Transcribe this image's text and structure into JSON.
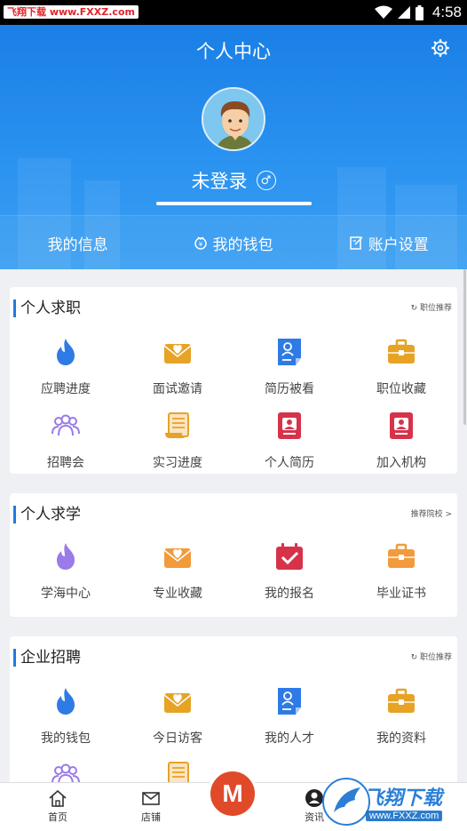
{
  "status_bar": {
    "watermark": "飞翔下载 www.FXXZ.com",
    "time": "4:58"
  },
  "header": {
    "title": "个人中心",
    "login_text": "未登录",
    "gender_symbol": "♂",
    "nav": [
      {
        "label": "我的信息",
        "icon": ""
      },
      {
        "label": "我的钱包",
        "icon": "wallet-icon"
      },
      {
        "label": "账户设置",
        "icon": "edit-icon"
      }
    ]
  },
  "sections": {
    "job": {
      "title": "个人求职",
      "link": "职位推荐",
      "items": [
        {
          "label": "应聘进度",
          "icon": "flame-icon"
        },
        {
          "label": "面试邀请",
          "icon": "heart-envelope-icon"
        },
        {
          "label": "简历被看",
          "icon": "profile-doc-icon"
        },
        {
          "label": "职位收藏",
          "icon": "briefcase-icon"
        },
        {
          "label": "招聘会",
          "icon": "group-icon"
        },
        {
          "label": "实习进度",
          "icon": "scroll-icon"
        },
        {
          "label": "个人简历",
          "icon": "id-book-icon"
        },
        {
          "label": "加入机构",
          "icon": "id-book-icon"
        }
      ]
    },
    "study": {
      "title": "个人求学",
      "link": "推荐院校 >",
      "items": [
        {
          "label": "学海中心",
          "icon": "flame-icon"
        },
        {
          "label": "专业收藏",
          "icon": "heart-envelope-icon"
        },
        {
          "label": "我的报名",
          "icon": "calendar-check-icon"
        },
        {
          "label": "毕业证书",
          "icon": "briefcase-icon"
        }
      ]
    },
    "enterprise": {
      "title": "企业招聘",
      "link": "职位推荐",
      "items": [
        {
          "label": "我的钱包",
          "icon": "flame-icon"
        },
        {
          "label": "今日访客",
          "icon": "heart-envelope-icon"
        },
        {
          "label": "我的人才",
          "icon": "profile-doc-icon"
        },
        {
          "label": "我的资料",
          "icon": "briefcase-icon"
        }
      ]
    }
  },
  "bottom_nav": {
    "items": [
      {
        "label": "首页",
        "icon": "home-icon"
      },
      {
        "label": "店铺",
        "icon": "mail-icon"
      },
      {
        "label": "资讯",
        "icon": "person-icon"
      }
    ],
    "center_label": "M"
  },
  "watermark": {
    "name": "飞翔下载",
    "url": "www.FXXZ.com"
  },
  "colors": {
    "header_blue": "#1a7fe6",
    "flame_blue": "#2e7be6",
    "flame_purple": "#9a7be8",
    "gold": "#e6a326",
    "orange": "#f29b3c",
    "crimson": "#d6334a",
    "accent_red": "#e04a2b"
  }
}
